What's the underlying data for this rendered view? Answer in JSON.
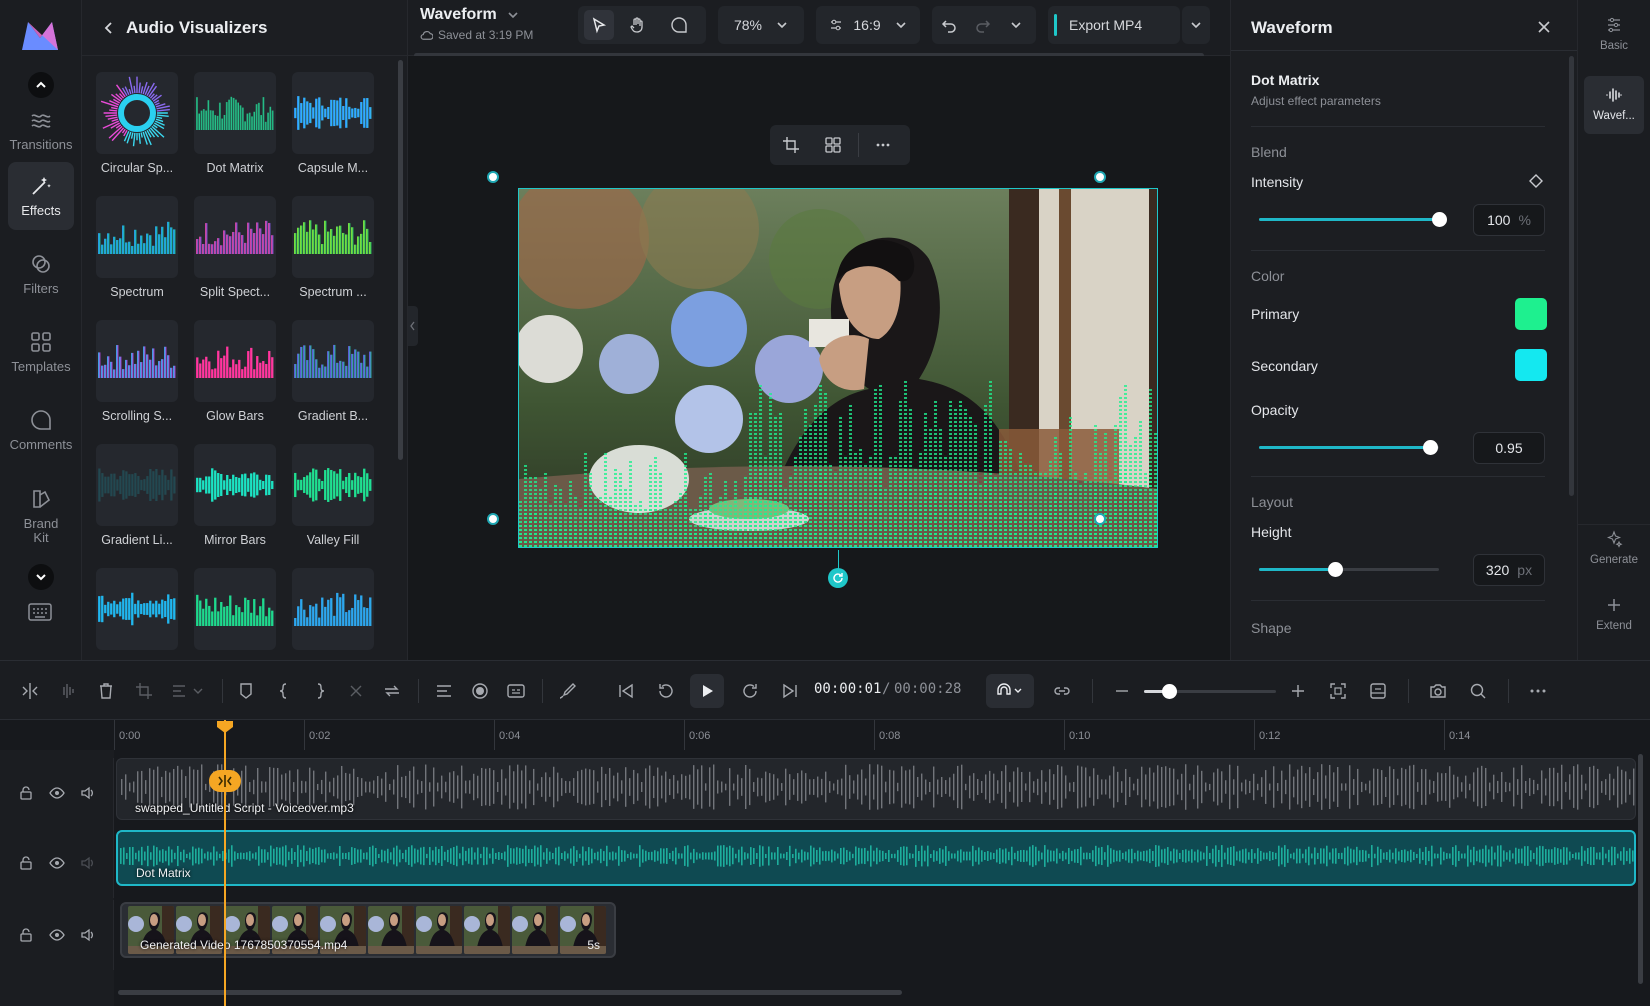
{
  "nav": {
    "items": [
      {
        "label": "Transitions"
      },
      {
        "label": "Effects"
      },
      {
        "label": "Filters"
      },
      {
        "label": "Templates"
      },
      {
        "label": "Comments"
      },
      {
        "label": "Brand Kit"
      }
    ]
  },
  "library": {
    "title": "Audio Visualizers",
    "tiles": [
      {
        "label": "Circular Sp..."
      },
      {
        "label": "Dot Matrix"
      },
      {
        "label": "Capsule M..."
      },
      {
        "label": "Spectrum"
      },
      {
        "label": "Split Spect..."
      },
      {
        "label": "Spectrum ..."
      },
      {
        "label": "Scrolling S..."
      },
      {
        "label": "Glow Bars"
      },
      {
        "label": "Gradient B..."
      },
      {
        "label": "Gradient Li..."
      },
      {
        "label": "Mirror Bars"
      },
      {
        "label": "Valley Fill"
      }
    ]
  },
  "project": {
    "name": "Waveform",
    "saved": "Saved at 3:19 PM"
  },
  "toolbar": {
    "zoom": "78%",
    "ratio": "16:9",
    "export_label": "Export MP4"
  },
  "props": {
    "title": "Waveform",
    "effect_name": "Dot Matrix",
    "effect_sub": "Adjust effect parameters",
    "blend_section": "Blend",
    "intensity_label": "Intensity",
    "intensity_value": "100",
    "intensity_unit": "%",
    "intensity_level": 1.0,
    "color_section": "Color",
    "primary_label": "Primary",
    "primary_color": "#1ef08f",
    "secondary_label": "Secondary",
    "secondary_color": "#14e8f0",
    "opacity_label": "Opacity",
    "opacity_value": "0.95",
    "opacity_level": 0.95,
    "layout_section": "Layout",
    "height_label": "Height",
    "height_value": "320",
    "height_unit": "px",
    "height_level": 0.42,
    "shape_section": "Shape"
  },
  "right_rail": {
    "basic": "Basic",
    "waveform": "Wavef...",
    "generate": "Generate",
    "extend": "Extend"
  },
  "timeline": {
    "current_time": "00:00:01",
    "total_time": "00:00:28",
    "ticks": [
      "0:00",
      "0:02",
      "0:04",
      "0:06",
      "0:08",
      "0:10",
      "0:12",
      "0:14"
    ],
    "tracks": [
      {
        "clip": "swapped_Untitled Script - Voiceover.mp3"
      },
      {
        "clip": "Dot Matrix"
      },
      {
        "clip": "Generated Video 1767850370554.mp4",
        "badge": "5s"
      }
    ]
  },
  "colors": {
    "accent": "#1fc7c9",
    "playhead": "#f5a623",
    "waveform_green": "#1ef08f"
  }
}
